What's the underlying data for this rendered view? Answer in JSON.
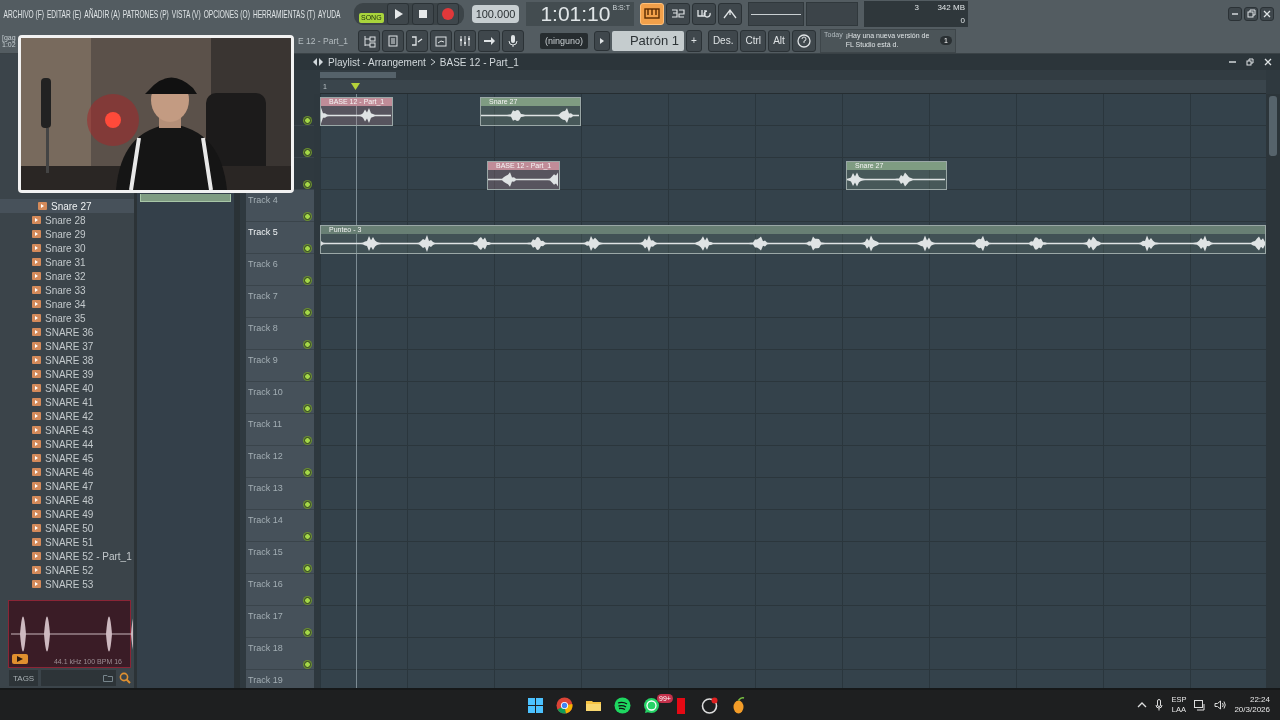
{
  "menu": [
    "ARCHIVO (F)",
    "EDITAR (E)",
    "AÑADIR (A)",
    "PATRONES (P)",
    "VISTA (V)",
    "OPCIONES (O)",
    "HERRAMIENTAS (T)",
    "AYUDA"
  ],
  "transport": {
    "mode": "SONG",
    "tempo": "100.000",
    "time": "1:01:10",
    "time_format": "B:S:T"
  },
  "view_buttons": [
    {
      "selected": true
    },
    {
      "selected": false
    },
    {
      "selected": false
    },
    {
      "selected": false
    }
  ],
  "monitor": {
    "cpu": "3",
    "memory": "342 MB",
    "polyphony": "0"
  },
  "toolbar": {
    "hidden_left": [
      "[gag",
      "1:02"
    ],
    "browser_path": "E 12 - Part_1",
    "preset": "(ninguno)",
    "pattern": "Patrón 1",
    "add": "+",
    "keys": [
      "Des.",
      "Ctrl",
      "Alt"
    ],
    "hint_date": "Today",
    "hint": "¡Hay una nueva versión de FL Studio está d.",
    "hint_badge": "1"
  },
  "browser": {
    "items": [
      {
        "label": "Snare 27",
        "selected": true
      },
      {
        "label": "Snare 28",
        "selected": false
      },
      {
        "label": "Snare 29",
        "selected": false
      },
      {
        "label": "Snare 30",
        "selected": false
      },
      {
        "label": "Snare 31",
        "selected": false
      },
      {
        "label": "Snare 32",
        "selected": false
      },
      {
        "label": "Snare 33",
        "selected": false
      },
      {
        "label": "Snare 34",
        "selected": false
      },
      {
        "label": "Snare 35",
        "selected": false
      },
      {
        "label": "SNARE 36",
        "selected": false
      },
      {
        "label": "SNARE 37",
        "selected": false
      },
      {
        "label": "SNARE 38",
        "selected": false
      },
      {
        "label": "SNARE 39",
        "selected": false
      },
      {
        "label": "SNARE 40",
        "selected": false
      },
      {
        "label": "SNARE 41",
        "selected": false
      },
      {
        "label": "SNARE 42",
        "selected": false
      },
      {
        "label": "SNARE 43",
        "selected": false
      },
      {
        "label": "SNARE 44",
        "selected": false
      },
      {
        "label": "SNARE 45",
        "selected": false
      },
      {
        "label": "SNARE 46",
        "selected": false
      },
      {
        "label": "SNARE 47",
        "selected": false
      },
      {
        "label": "SNARE 48",
        "selected": false
      },
      {
        "label": "SNARE 49",
        "selected": false
      },
      {
        "label": "SNARE 50",
        "selected": false
      },
      {
        "label": "SNARE 51",
        "selected": false
      },
      {
        "label": "SNARE 52 - Part_1",
        "selected": false
      },
      {
        "label": "SNARE 52",
        "selected": false
      },
      {
        "label": "SNARE 53",
        "selected": false
      }
    ],
    "preview_info": "44.1 kHz 100 BPM 16",
    "tags": "TAGS"
  },
  "picker": {
    "clips": [
      {
        "color": "#7f9c82"
      }
    ]
  },
  "playlist": {
    "title": "Playlist - Arrangement",
    "pattern": "BASE 12 - Part_1",
    "ruler": "1",
    "tracks": [
      {
        "enabled": true,
        "clips": [
          {
            "name": "BASE 12 - Part_1",
            "color": "#c08c98"
          },
          {
            "name": "Snare 27",
            "color": "#7f9c82"
          }
        ]
      },
      {
        "enabled": true
      },
      {
        "enabled": true,
        "clips": [
          {
            "name": "BASE 12 - Part_1",
            "color": "#c08c98"
          },
          {
            "name": "Snare 27",
            "color": "#7f9c82"
          }
        ]
      },
      {
        "name": "Track 4",
        "active": false,
        "enabled": true
      },
      {
        "name": "Track 5",
        "active": true,
        "enabled": true,
        "clips": [
          {
            "name": "Punteo - 3",
            "color": "#687f74"
          }
        ]
      },
      {
        "name": "Track 6",
        "active": false,
        "enabled": true
      },
      {
        "name": "Track 7",
        "active": false,
        "enabled": true
      },
      {
        "name": "Track 8",
        "active": false,
        "enabled": true
      },
      {
        "name": "Track 9",
        "active": false,
        "enabled": true
      },
      {
        "name": "Track 10",
        "active": false,
        "enabled": true
      },
      {
        "name": "Track 11",
        "active": false,
        "enabled": true
      },
      {
        "name": "Track 12",
        "active": false,
        "enabled": true
      },
      {
        "name": "Track 13",
        "active": false,
        "enabled": true
      },
      {
        "name": "Track 14",
        "active": false,
        "enabled": true
      },
      {
        "name": "Track 15",
        "active": false,
        "enabled": true
      },
      {
        "name": "Track 16",
        "active": false,
        "enabled": true
      },
      {
        "name": "Track 17",
        "active": false,
        "enabled": true
      },
      {
        "name": "Track 18",
        "active": false,
        "enabled": true
      },
      {
        "name": "Track 19",
        "active": false
      }
    ]
  },
  "taskbar": {
    "badge": "99+",
    "language": "ESP",
    "layout": "LAA",
    "time": "22:24",
    "date": "20/3/2026"
  }
}
